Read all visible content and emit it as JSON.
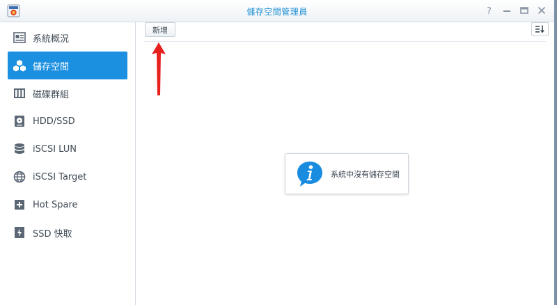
{
  "window": {
    "title": "儲存空間管理員",
    "app_icon": "storage-manager-icon",
    "controls": [
      {
        "name": "help",
        "glyph": "?"
      },
      {
        "name": "minimize",
        "glyph": "—"
      },
      {
        "name": "maximize",
        "glyph": "▭"
      },
      {
        "name": "close",
        "glyph": "✕"
      }
    ]
  },
  "sidebar": {
    "items": [
      {
        "label": "系統概況",
        "icon": "overview-icon",
        "active": false
      },
      {
        "label": "儲存空間",
        "icon": "cubes-icon",
        "active": true
      },
      {
        "label": "磁碟群組",
        "icon": "disk-group-icon",
        "active": false
      },
      {
        "label": "HDD/SSD",
        "icon": "hdd-icon",
        "active": false
      },
      {
        "label": "iSCSI LUN",
        "icon": "database-icon",
        "active": false
      },
      {
        "label": "iSCSI Target",
        "icon": "globe-icon",
        "active": false
      },
      {
        "label": "Hot Spare",
        "icon": "hot-spare-icon",
        "active": false
      },
      {
        "label": "SSD 快取",
        "icon": "ssd-cache-icon",
        "active": false
      }
    ]
  },
  "toolbar": {
    "new_label": "新增",
    "sort_icon": "sort-icon"
  },
  "empty_state": {
    "message": "系統中沒有儲存空間",
    "icon": "info-bubble-icon"
  },
  "annotation": {
    "icon": "red-arrow-up-icon",
    "color": "#e8201c"
  },
  "colors": {
    "accent": "#1b8fe0",
    "title": "#1f8fd3"
  }
}
